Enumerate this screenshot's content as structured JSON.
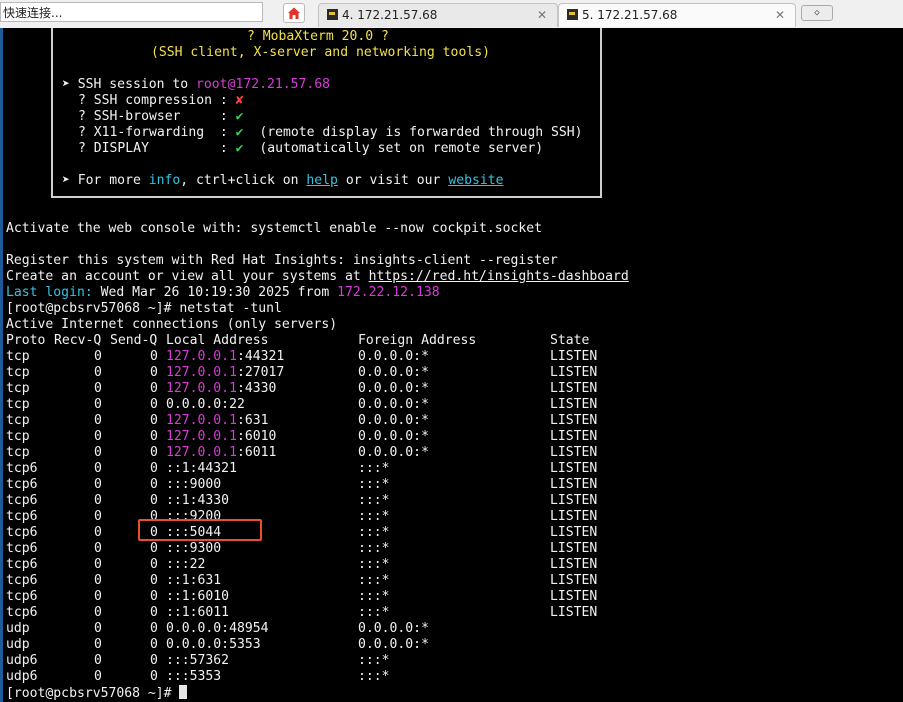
{
  "quick_connect": {
    "placeholder": "快速连接..."
  },
  "tabs": [
    {
      "label": "4. 172.21.57.68"
    },
    {
      "label": "5. 172.21.57.68"
    }
  ],
  "tab_close": "✕",
  "new_tab_symbol": "◇",
  "banner": {
    "product": "? MobaXterm 20.0 ?",
    "subtitle": "(SSH client, X-server and networking tools)",
    "ssh_prefix": "➤ SSH session to ",
    "ssh_user": "root",
    "ssh_host": "@172.21.57.68",
    "opt1_label": "? SSH compression : ",
    "opt1_mark": "✘",
    "opt2_label": "? SSH-browser     : ",
    "opt2_mark": "✔",
    "opt3_label": "? X11-forwarding  : ",
    "opt3_mark": "✔",
    "opt3_note": "  (remote display is forwarded through SSH)",
    "opt4_label": "? DISPLAY         : ",
    "opt4_mark": "✔",
    "opt4_note": "  (automatically set on remote server)",
    "more_prefix": "➤ For more ",
    "more_info": "info",
    "more_mid": ", ctrl+click on ",
    "more_help": "help",
    "more_mid2": " or visit our ",
    "more_website": "website"
  },
  "console": {
    "cockpit": "Activate the web console with: systemctl enable --now cockpit.socket",
    "insights1": "Register this system with Red Hat Insights: insights-client --register",
    "insights2_prefix": "Create an account or view all your systems at ",
    "insights2_link": "https://red.ht/insights-dashboard",
    "last_login_label": "Last login:",
    "last_login_text": " Wed Mar 26 10:19:30 2025 from ",
    "last_login_ip": "172.22.12.138",
    "prompt_cmd": "[root@pcbsrv57068 ~]# netstat -tunl",
    "heading": "Active Internet connections (only servers)",
    "final_prompt": "[root@pcbsrv57068 ~]# "
  },
  "netstat": {
    "headers": [
      "Proto",
      "Recv-Q",
      "Send-Q",
      "Local Address",
      "Foreign Address",
      "State"
    ],
    "rows": [
      {
        "proto": "tcp",
        "recvq": "0",
        "sendq": "0",
        "local_ip": "127.0.0.1",
        "local_port": ":44321",
        "foreign": "0.0.0.0:*",
        "state": "LISTEN"
      },
      {
        "proto": "tcp",
        "recvq": "0",
        "sendq": "0",
        "local_ip": "127.0.0.1",
        "local_port": ":27017",
        "foreign": "0.0.0.0:*",
        "state": "LISTEN"
      },
      {
        "proto": "tcp",
        "recvq": "0",
        "sendq": "0",
        "local_ip": "127.0.0.1",
        "local_port": ":4330",
        "foreign": "0.0.0.0:*",
        "state": "LISTEN"
      },
      {
        "proto": "tcp",
        "recvq": "0",
        "sendq": "0",
        "local_ip": "",
        "local_port": "0.0.0.0:22",
        "foreign": "0.0.0.0:*",
        "state": "LISTEN"
      },
      {
        "proto": "tcp",
        "recvq": "0",
        "sendq": "0",
        "local_ip": "127.0.0.1",
        "local_port": ":631",
        "foreign": "0.0.0.0:*",
        "state": "LISTEN"
      },
      {
        "proto": "tcp",
        "recvq": "0",
        "sendq": "0",
        "local_ip": "127.0.0.1",
        "local_port": ":6010",
        "foreign": "0.0.0.0:*",
        "state": "LISTEN"
      },
      {
        "proto": "tcp",
        "recvq": "0",
        "sendq": "0",
        "local_ip": "127.0.0.1",
        "local_port": ":6011",
        "foreign": "0.0.0.0:*",
        "state": "LISTEN"
      },
      {
        "proto": "tcp6",
        "recvq": "0",
        "sendq": "0",
        "local_ip": "",
        "local_port": "::1:44321",
        "foreign": ":::*",
        "state": "LISTEN"
      },
      {
        "proto": "tcp6",
        "recvq": "0",
        "sendq": "0",
        "local_ip": "",
        "local_port": ":::9000",
        "foreign": ":::*",
        "state": "LISTEN"
      },
      {
        "proto": "tcp6",
        "recvq": "0",
        "sendq": "0",
        "local_ip": "",
        "local_port": "::1:4330",
        "foreign": ":::*",
        "state": "LISTEN"
      },
      {
        "proto": "tcp6",
        "recvq": "0",
        "sendq": "0",
        "local_ip": "",
        "local_port": ":::9200",
        "foreign": ":::*",
        "state": "LISTEN"
      },
      {
        "proto": "tcp6",
        "recvq": "0",
        "sendq": "0",
        "local_ip": "",
        "local_port": ":::5044",
        "foreign": ":::*",
        "state": "LISTEN"
      },
      {
        "proto": "tcp6",
        "recvq": "0",
        "sendq": "0",
        "local_ip": "",
        "local_port": ":::9300",
        "foreign": ":::*",
        "state": "LISTEN"
      },
      {
        "proto": "tcp6",
        "recvq": "0",
        "sendq": "0",
        "local_ip": "",
        "local_port": ":::22",
        "foreign": ":::*",
        "state": "LISTEN"
      },
      {
        "proto": "tcp6",
        "recvq": "0",
        "sendq": "0",
        "local_ip": "",
        "local_port": "::1:631",
        "foreign": ":::*",
        "state": "LISTEN"
      },
      {
        "proto": "tcp6",
        "recvq": "0",
        "sendq": "0",
        "local_ip": "",
        "local_port": "::1:6010",
        "foreign": ":::*",
        "state": "LISTEN"
      },
      {
        "proto": "tcp6",
        "recvq": "0",
        "sendq": "0",
        "local_ip": "",
        "local_port": "::1:6011",
        "foreign": ":::*",
        "state": "LISTEN"
      },
      {
        "proto": "udp",
        "recvq": "0",
        "sendq": "0",
        "local_ip": "",
        "local_port": "0.0.0.0:48954",
        "foreign": "0.0.0.0:*",
        "state": ""
      },
      {
        "proto": "udp",
        "recvq": "0",
        "sendq": "0",
        "local_ip": "",
        "local_port": "0.0.0.0:5353",
        "foreign": "0.0.0.0:*",
        "state": ""
      },
      {
        "proto": "udp6",
        "recvq": "0",
        "sendq": "0",
        "local_ip": "",
        "local_port": ":::57362",
        "foreign": ":::*",
        "state": ""
      },
      {
        "proto": "udp6",
        "recvq": "0",
        "sendq": "0",
        "local_ip": "",
        "local_port": ":::5353",
        "foreign": ":::*",
        "state": ""
      }
    ]
  },
  "colors": {
    "terminal_bg": "#000000",
    "text": "#f2f2f2",
    "yellow": "#f3e04d",
    "magenta": "#d93ad9",
    "cyan": "#36c3e3",
    "highlight_box": "#e8502d"
  }
}
